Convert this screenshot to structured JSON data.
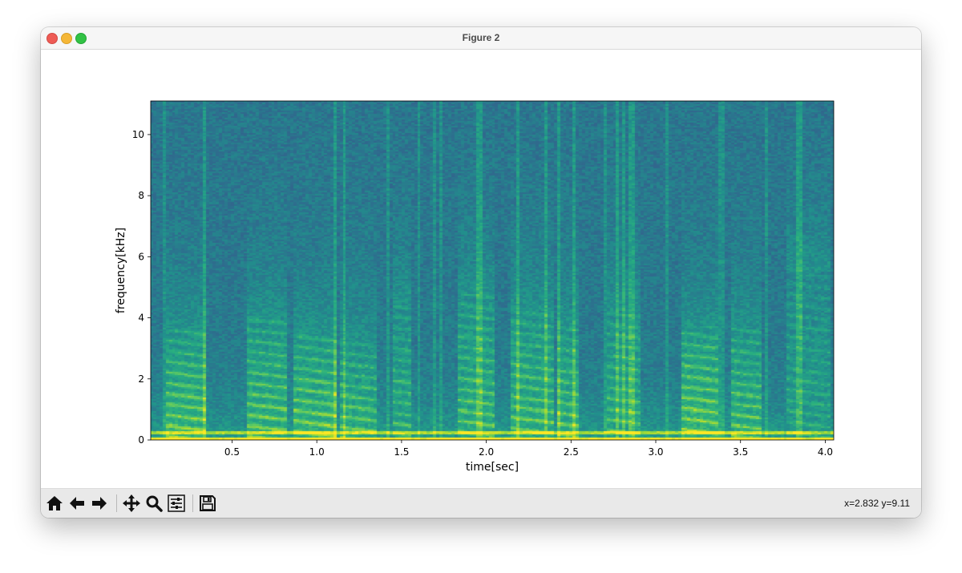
{
  "window": {
    "title": "Figure 2"
  },
  "toolbar": {
    "buttons": [
      {
        "name": "home-button",
        "icon": "home-icon"
      },
      {
        "name": "back-button",
        "icon": "arrow-left-icon"
      },
      {
        "name": "forward-button",
        "icon": "arrow-right-icon"
      },
      {
        "name": "pan-button",
        "icon": "move-icon"
      },
      {
        "name": "zoom-button",
        "icon": "magnifier-icon"
      },
      {
        "name": "configure-subplots-button",
        "icon": "sliders-icon"
      },
      {
        "name": "save-button",
        "icon": "floppy-disk-icon"
      }
    ],
    "coordinates": "x=2.832 y=9.11"
  },
  "chart_data": {
    "type": "heatmap",
    "title": "",
    "xlabel": "time[sec]",
    "ylabel": "frequency[kHz]",
    "xlim": [
      0.02,
      4.05
    ],
    "ylim": [
      0,
      11.1
    ],
    "xticks": [
      0.5,
      1.0,
      1.5,
      2.0,
      2.5,
      3.0,
      3.5,
      4.0
    ],
    "xtick_labels": [
      "0.5",
      "1.0",
      "1.5",
      "2.0",
      "2.5",
      "3.0",
      "3.5",
      "4.0"
    ],
    "yticks": [
      0,
      2,
      4,
      6,
      8,
      10
    ],
    "ytick_labels": [
      "0",
      "2",
      "4",
      "6",
      "8",
      "10"
    ],
    "colormap": [
      "#3b528b",
      "#2c728e",
      "#21918c",
      "#28ae80",
      "#5ec962",
      "#addc30",
      "#fde725"
    ],
    "grid": false,
    "legend": "none",
    "speech_segments": [
      {
        "t_start": 0.12,
        "t_end": 0.35,
        "f_max_khz": 3.6,
        "intensity": 0.85
      },
      {
        "t_start": 0.58,
        "t_end": 0.82,
        "f_max_khz": 4.0,
        "intensity": 0.8
      },
      {
        "t_start": 0.86,
        "t_end": 1.12,
        "f_max_khz": 3.5,
        "intensity": 0.85
      },
      {
        "t_start": 1.13,
        "t_end": 1.36,
        "f_max_khz": 3.2,
        "intensity": 0.75
      },
      {
        "t_start": 1.44,
        "t_end": 1.55,
        "f_max_khz": 4.5,
        "intensity": 0.6
      },
      {
        "t_start": 1.84,
        "t_end": 2.06,
        "f_max_khz": 4.8,
        "intensity": 0.7
      },
      {
        "t_start": 2.14,
        "t_end": 2.4,
        "f_max_khz": 4.2,
        "intensity": 0.75
      },
      {
        "t_start": 2.42,
        "t_end": 2.55,
        "f_max_khz": 3.7,
        "intensity": 0.75
      },
      {
        "t_start": 2.72,
        "t_end": 2.92,
        "f_max_khz": 4.2,
        "intensity": 0.65
      },
      {
        "t_start": 3.15,
        "t_end": 3.38,
        "f_max_khz": 3.7,
        "intensity": 0.9
      },
      {
        "t_start": 3.45,
        "t_end": 3.62,
        "f_max_khz": 3.8,
        "intensity": 0.75
      },
      {
        "t_start": 3.78,
        "t_end": 4.03,
        "f_max_khz": 5.5,
        "intensity": 0.45
      }
    ],
    "pitch_band_khz": [
      0.15,
      0.3
    ],
    "coordinate_readout": {
      "x": 2.832,
      "y": 9.11
    }
  }
}
